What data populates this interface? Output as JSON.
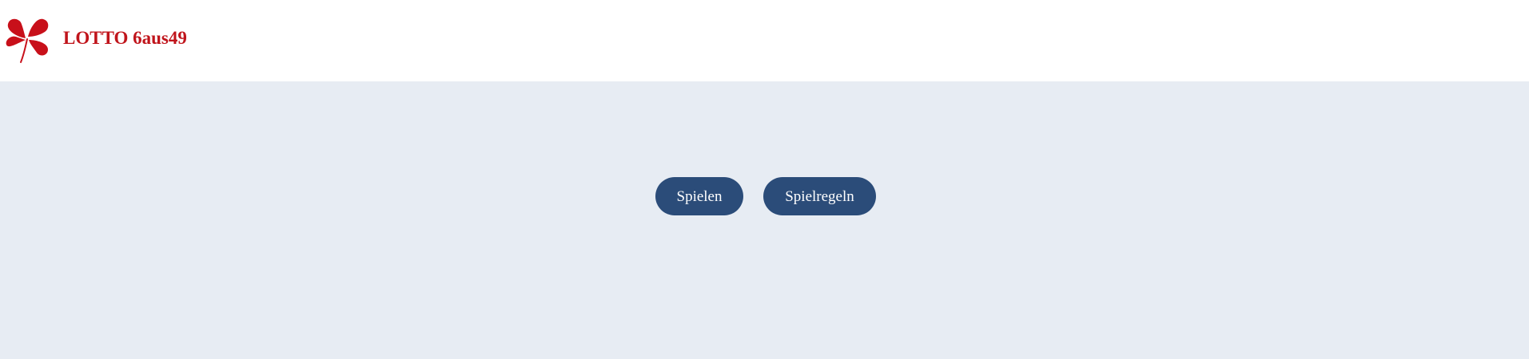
{
  "header": {
    "brand_title": "LOTTO 6aus49",
    "logo_icon": "clover-icon",
    "brand_color": "#c0141b"
  },
  "main": {
    "background_color": "#e7ecf3",
    "buttons": [
      {
        "label": "Spielen"
      },
      {
        "label": "Spielregeln"
      }
    ],
    "button_color": "#2b4c79"
  }
}
